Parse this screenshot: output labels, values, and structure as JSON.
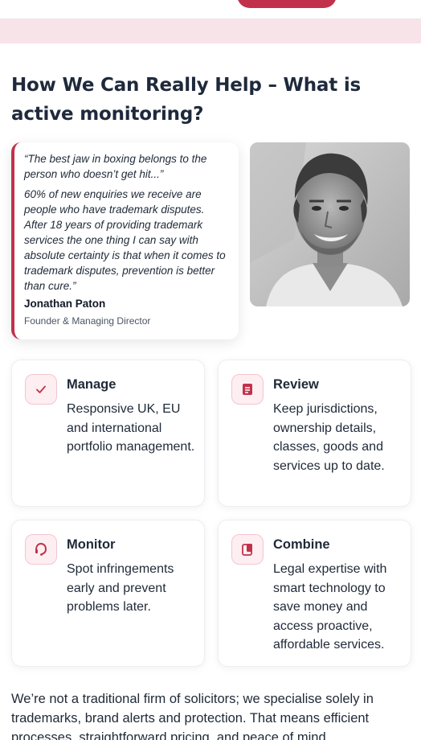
{
  "heading": "How We Can Really Help – What is active monitoring?",
  "quote": {
    "line1": "“The best jaw in boxing belongs to the person who doesn’t get hit...”",
    "line2": "60% of new enquiries we receive are people who have trademark disputes. After 18 years of providing trademark services the one thing I can say with absolute certainty is that when it comes to trademark disputes, prevention is better than cure.”",
    "author": "Jonathan Paton",
    "role": "Founder & Managing Director"
  },
  "features": [
    {
      "title": "Manage",
      "text": "Responsive UK, EU and international portfolio management.",
      "icon": "checkmark-icon"
    },
    {
      "title": "Review",
      "text": "Keep jurisdictions, ownership details, classes, goods and services up to date.",
      "icon": "document-icon"
    },
    {
      "title": "Monitor",
      "text": "Spot infringements early and prevent problems later.",
      "icon": "headset-icon"
    },
    {
      "title": "Combine",
      "text": "Legal expertise with smart technology to save money and access proactive, affordable services.",
      "icon": "files-icon"
    }
  ],
  "bottom_text": "We’re not a traditional firm of solicitors; we specialise solely in trademarks, brand alerts and protection. That means efficient processes, straightforward pricing, and peace of mind.",
  "colors": {
    "accent": "#c2314b",
    "band": "#f8e4e8",
    "icon_bg": "#fdeef1"
  }
}
